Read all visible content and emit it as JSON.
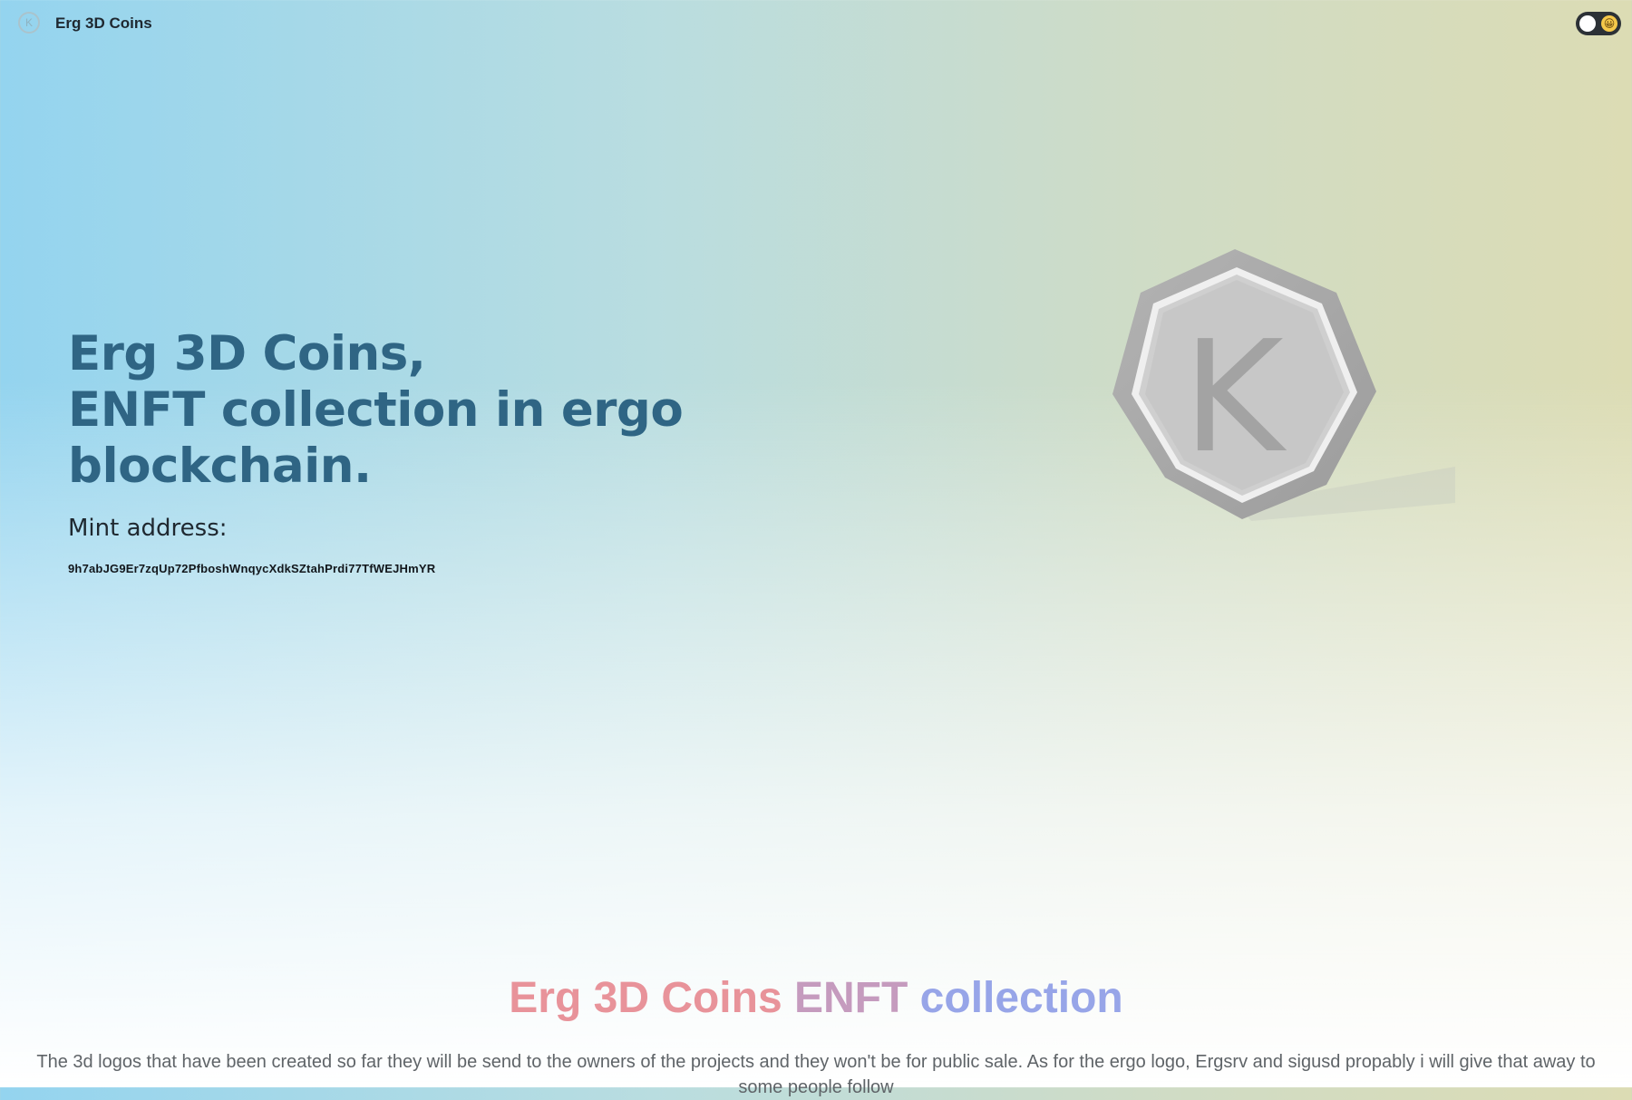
{
  "header": {
    "brand_title": "Erg 3D Coins",
    "logo_letter": "K",
    "theme_toggle_emoji": "😀"
  },
  "hero": {
    "title_line1": "Erg 3D Coins,",
    "title_line2": "ENFT collection in ergo blockchain.",
    "mint_label": "Mint address:",
    "mint_address": "9h7abJG9Er7zqUp72PfboshWnqycXdkSZtahPrdi77TfWEJHmYR",
    "coin_letter": "K"
  },
  "collection": {
    "title_part1": "Erg 3D Coins",
    "title_part2": "ENFT",
    "title_part3": "collection",
    "description": "The 3d logos that have been created so far they will be send to the owners of the projects and they won't be for public sale. As for the ergo logo, Ergsrv and sigusd propably i will give that away to some people follow"
  },
  "colors": {
    "hero_title": "#2f6584",
    "title_pink": "#e8939a",
    "title_mauve": "#c59bbe",
    "title_blue": "#97a5e8",
    "toggle_bg": "#2c3136"
  }
}
